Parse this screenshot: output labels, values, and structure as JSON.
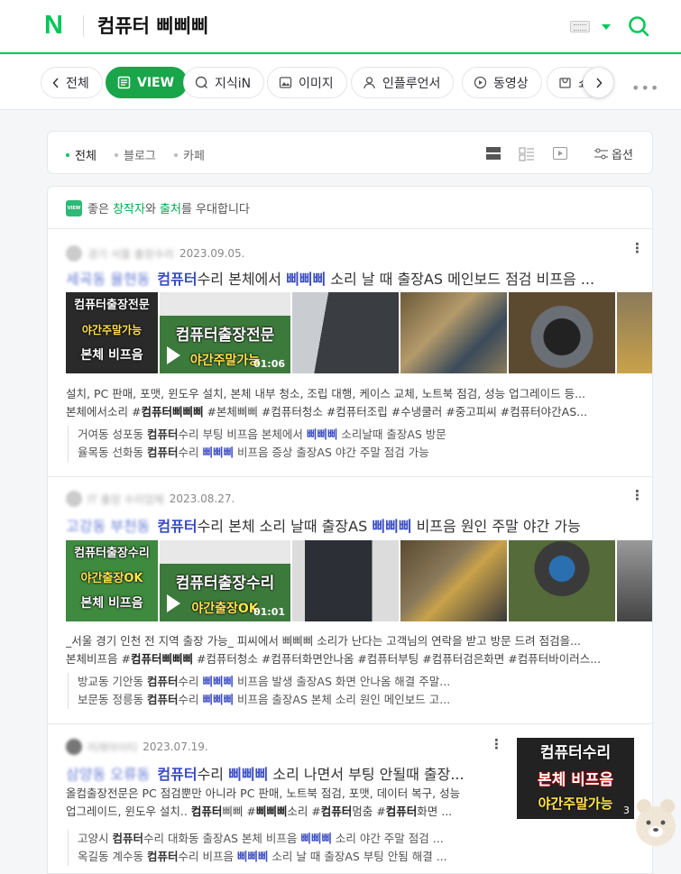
{
  "header": {
    "logo": "N",
    "query": "컴퓨터 삐삐삐"
  },
  "tabs": [
    {
      "label": "전체",
      "icon": "chevron-left-icon"
    },
    {
      "label": "VIEW",
      "icon": "view-icon",
      "active": true
    },
    {
      "label": "지식iN",
      "icon": "kin-icon"
    },
    {
      "label": "이미지",
      "icon": "image-icon"
    },
    {
      "label": "인플루언서",
      "icon": "person-icon"
    },
    {
      "label": "동영상",
      "icon": "play-icon"
    },
    {
      "label": "쇼",
      "icon": "shopping-icon"
    }
  ],
  "filters": {
    "all": "전체",
    "blog": "블로그",
    "cafe": "카페",
    "options": "옵션"
  },
  "notice": {
    "prefix": "좋은 ",
    "creator": "창작자",
    "middle": "와 ",
    "source": "출처",
    "suffix": "를 우대합니다",
    "badge": "VIEW"
  },
  "posts": [
    {
      "author": "경기 서울 출장수리",
      "date": "2023.09.05.",
      "title_prefix": "세곡동 율현동",
      "title_1": "컴퓨터",
      "title_2": "수리 본체에서 ",
      "title_3": "삐삐삐",
      "title_4": " 소리 날 때 출장AS 메인보드 점검 비프음 ...",
      "thumb_caption_1": "컴퓨터출장전문",
      "thumb_caption_2": "야간주말가능",
      "thumb_caption_3": "본체 비프음",
      "video_caption_1": "컴퓨터출장전문",
      "video_caption_2": "야간주말가능",
      "duration": "01:06",
      "desc_1": "설치, PC 판매, 포맷, 윈도우 설치, 본체 내부 청소, 조립 대행, 케이스 교체, 노트북 점검, 성능 업그레이드 등...",
      "desc_2_a": "본체에서소리 #",
      "desc_2_b": "컴퓨터삐삐삐",
      "desc_2_c": " #본체삐삐 #컴퓨터청소 #컴퓨터조립 #수냉쿨러 #중고피씨 #컴퓨터야간AS...",
      "sub_1_a": "거여동 성포동 ",
      "sub_1_b": "컴퓨터",
      "sub_1_c": "수리 부팅 비프음 본체에서 ",
      "sub_1_d": "삐삐삐",
      "sub_1_e": " 소리날때 출장AS 방문",
      "sub_2_a": "율목동 선화동 ",
      "sub_2_b": "컴퓨터",
      "sub_2_c": "수리 ",
      "sub_2_d": "삐삐삐",
      "sub_2_e": " 비프음 증상 출장AS 야간 주말 점검 가능"
    },
    {
      "author": "IT 출장 수리업체",
      "date": "2023.08.27.",
      "title_prefix": "고강동 부천동",
      "title_1": "컴퓨터",
      "title_2": "수리 본체 소리 날때 출장AS ",
      "title_3": "삐삐삐",
      "title_4": " 비프음 원인 주말 야간 가능",
      "thumb_caption_1": "컴퓨터출장수리",
      "thumb_caption_2": "야간출장OK",
      "thumb_caption_3": "본체 비프음",
      "video_caption_1": "컴퓨터출장수리",
      "video_caption_2": "야간출장OK",
      "duration": "01:01",
      "desc_1": "_서울 경기 인천 전 지역 출장 가능_ 피씨에서 삐삐삐 소리가 난다는 고객님의 연락을 받고 방문 드려 점검을...",
      "desc_2_a": "본체비프음 #",
      "desc_2_b": "컴퓨터삐삐삐",
      "desc_2_c": " #컴퓨터청소 #컴퓨터화면안나옴 #컴퓨터부팅 #컴퓨터검은화면 #컴퓨터바이러스...",
      "sub_1_a": "방교동 기안동 ",
      "sub_1_b": "컴퓨터",
      "sub_1_c": "수리 ",
      "sub_1_d": "삐삐삐",
      "sub_1_e": " 비프음 발생 출장AS 화면 안나옴 해결 주말...",
      "sub_2_a": "보문동 정릉동 ",
      "sub_2_b": "컴퓨터",
      "sub_2_c": "수리 ",
      "sub_2_d": "삐삐삐",
      "sub_2_e": " 비프음 출장AS 본체 소리 원인 메인보드 고..."
    },
    {
      "author": "미래아이티",
      "date": "2023.07.19.",
      "title_prefix": "삼양동 오류동",
      "title_1": "컴퓨터",
      "title_2": "수리 ",
      "title_3": "삐삐삐",
      "title_4": " 소리 나면서 부팅 안될때 출장...",
      "desc_1": "올컴출장전문은 PC 점검뿐만 아니라 PC 판매, 노트북 점검, 포맷, 데이터 복구, 성능",
      "desc_2_a": "업그레이드, 윈도우 설치.. ",
      "desc_2_b": "컴퓨터",
      "desc_2_c": "삐삐 #",
      "desc_2_d": "삐삐삐",
      "desc_2_e": "소리 #",
      "desc_2_f": "컴퓨터",
      "desc_2_g": "멈춤 #",
      "desc_2_h": "컴퓨터",
      "desc_2_i": "화면 ...",
      "side_caption_1": "컴퓨터수리",
      "side_caption_2": "본체 비프음",
      "side_caption_3": "야간주말가능",
      "side_count": "3",
      "sub_1_a": "고양시 ",
      "sub_1_b": "컴퓨터",
      "sub_1_c": "수리 대화동 출장AS 본체 비프음 ",
      "sub_1_d": "삐삐삐",
      "sub_1_e": " 소리 야간 주말 점검 ...",
      "sub_2_a": "옥길동 계수동 ",
      "sub_2_b": "컴퓨터",
      "sub_2_c": "수리 비프음 ",
      "sub_2_d": "삐삐삐",
      "sub_2_e": " 소리 날 때 출장AS 부팅 안됨 해결 ..."
    }
  ],
  "colors": {
    "brand": "#03c75a",
    "active_tab": "#19a54a",
    "link": "#3b4cc0"
  }
}
